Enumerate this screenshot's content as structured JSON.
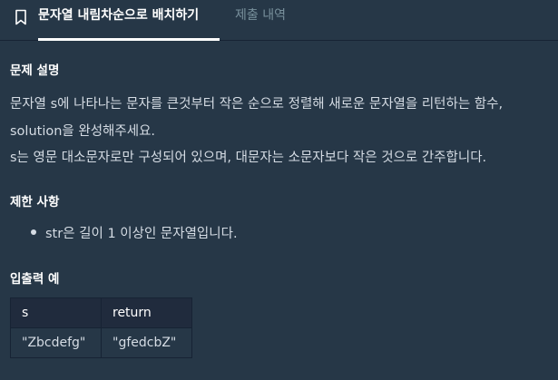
{
  "tabs": {
    "active_label": "문자열 내림차순으로 배치하기",
    "inactive_label": "제출 내역"
  },
  "description": {
    "heading": "문제 설명",
    "line1": "문자열 s에 나타나는 문자를 큰것부터 작은 순으로 정렬해 새로운 문자열을 리턴하는 함수,",
    "line2": "solution을 완성해주세요.",
    "line3": "s는 영문 대소문자로만 구성되어 있으며, 대문자는 소문자보다 작은 것으로 간주합니다."
  },
  "constraints": {
    "heading": "제한 사항",
    "items": [
      "str은 길이 1 이상인 문자열입니다."
    ]
  },
  "examples": {
    "heading": "입출력 예",
    "columns": [
      "s",
      "return"
    ],
    "rows": [
      [
        "\"Zbcdefg\"",
        "\"gfedcbZ\""
      ]
    ]
  },
  "colors": {
    "background": "#263747",
    "header_row": "#202b3d",
    "border": "#172334",
    "text": "#d5dce4",
    "inactive_tab": "#78909c"
  }
}
